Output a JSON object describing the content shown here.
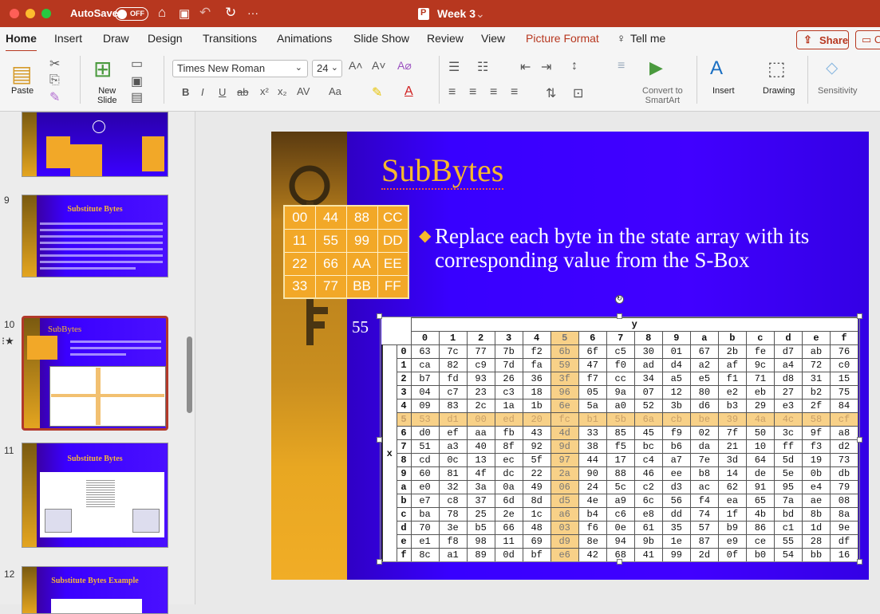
{
  "titlebar": {
    "autosave_label": "AutoSave",
    "autosave_state": "OFF",
    "doc_title": "Week 3",
    "caret": "⌄"
  },
  "tabs": [
    "Home",
    "Insert",
    "Draw",
    "Design",
    "Transitions",
    "Animations",
    "Slide Show",
    "Review",
    "View",
    "Picture Format",
    "Tell me"
  ],
  "share": {
    "label": "Share",
    "comment": "C"
  },
  "ribbon": {
    "paste": "Paste",
    "new_slide_1": "New",
    "new_slide_2": "Slide",
    "font_name": "Times New Roman",
    "font_size": "24",
    "convert_1": "Convert to",
    "convert_2": "SmartArt",
    "insert": "Insert",
    "drawing": "Drawing",
    "sensitivity": "Sensitivity"
  },
  "slides_panel": [
    {
      "num": "9",
      "title": "Substitute Bytes"
    },
    {
      "num": "10",
      "title": "SubBytes"
    },
    {
      "num": "11",
      "title": "Substitute Bytes"
    },
    {
      "num": "12",
      "title": "Substitute Bytes Example"
    }
  ],
  "slide": {
    "title": "SubBytes",
    "bullet": "Replace each byte in the state array with its corresponding value from the S-Box",
    "state": [
      [
        "00",
        "44",
        "88",
        "CC"
      ],
      [
        "11",
        "55",
        "99",
        "DD"
      ],
      [
        "22",
        "66",
        "AA",
        "EE"
      ],
      [
        "33",
        "77",
        "BB",
        "FF"
      ]
    ],
    "label55": "55",
    "sbox_y": "y",
    "sbox_x": "x",
    "sbox_cols": [
      "0",
      "1",
      "2",
      "3",
      "4",
      "5",
      "6",
      "7",
      "8",
      "9",
      "a",
      "b",
      "c",
      "d",
      "e",
      "f"
    ],
    "sbox_rows": [
      [
        "0",
        "63",
        "7c",
        "77",
        "7b",
        "f2",
        "6b",
        "6f",
        "c5",
        "30",
        "01",
        "67",
        "2b",
        "fe",
        "d7",
        "ab",
        "76"
      ],
      [
        "1",
        "ca",
        "82",
        "c9",
        "7d",
        "fa",
        "59",
        "47",
        "f0",
        "ad",
        "d4",
        "a2",
        "af",
        "9c",
        "a4",
        "72",
        "c0"
      ],
      [
        "2",
        "b7",
        "fd",
        "93",
        "26",
        "36",
        "3f",
        "f7",
        "cc",
        "34",
        "a5",
        "e5",
        "f1",
        "71",
        "d8",
        "31",
        "15"
      ],
      [
        "3",
        "04",
        "c7",
        "23",
        "c3",
        "18",
        "96",
        "05",
        "9a",
        "07",
        "12",
        "80",
        "e2",
        "eb",
        "27",
        "b2",
        "75"
      ],
      [
        "4",
        "09",
        "83",
        "2c",
        "1a",
        "1b",
        "6e",
        "5a",
        "a0",
        "52",
        "3b",
        "d6",
        "b3",
        "29",
        "e3",
        "2f",
        "84"
      ],
      [
        "5",
        "53",
        "d1",
        "00",
        "ed",
        "20",
        "fc",
        "b1",
        "5b",
        "6a",
        "cb",
        "be",
        "39",
        "4a",
        "4c",
        "58",
        "cf"
      ],
      [
        "6",
        "d0",
        "ef",
        "aa",
        "fb",
        "43",
        "4d",
        "33",
        "85",
        "45",
        "f9",
        "02",
        "7f",
        "50",
        "3c",
        "9f",
        "a8"
      ],
      [
        "7",
        "51",
        "a3",
        "40",
        "8f",
        "92",
        "9d",
        "38",
        "f5",
        "bc",
        "b6",
        "da",
        "21",
        "10",
        "ff",
        "f3",
        "d2"
      ],
      [
        "8",
        "cd",
        "0c",
        "13",
        "ec",
        "5f",
        "97",
        "44",
        "17",
        "c4",
        "a7",
        "7e",
        "3d",
        "64",
        "5d",
        "19",
        "73"
      ],
      [
        "9",
        "60",
        "81",
        "4f",
        "dc",
        "22",
        "2a",
        "90",
        "88",
        "46",
        "ee",
        "b8",
        "14",
        "de",
        "5e",
        "0b",
        "db"
      ],
      [
        "a",
        "e0",
        "32",
        "3a",
        "0a",
        "49",
        "06",
        "24",
        "5c",
        "c2",
        "d3",
        "ac",
        "62",
        "91",
        "95",
        "e4",
        "79"
      ],
      [
        "b",
        "e7",
        "c8",
        "37",
        "6d",
        "8d",
        "d5",
        "4e",
        "a9",
        "6c",
        "56",
        "f4",
        "ea",
        "65",
        "7a",
        "ae",
        "08"
      ],
      [
        "c",
        "ba",
        "78",
        "25",
        "2e",
        "1c",
        "a6",
        "b4",
        "c6",
        "e8",
        "dd",
        "74",
        "1f",
        "4b",
        "bd",
        "8b",
        "8a"
      ],
      [
        "d",
        "70",
        "3e",
        "b5",
        "66",
        "48",
        "03",
        "f6",
        "0e",
        "61",
        "35",
        "57",
        "b9",
        "86",
        "c1",
        "1d",
        "9e"
      ],
      [
        "e",
        "e1",
        "f8",
        "98",
        "11",
        "69",
        "d9",
        "8e",
        "94",
        "9b",
        "1e",
        "87",
        "e9",
        "ce",
        "55",
        "28",
        "df"
      ],
      [
        "f",
        "8c",
        "a1",
        "89",
        "0d",
        "bf",
        "e6",
        "42",
        "68",
        "41",
        "99",
        "2d",
        "0f",
        "b0",
        "54",
        "bb",
        "16"
      ]
    ]
  }
}
